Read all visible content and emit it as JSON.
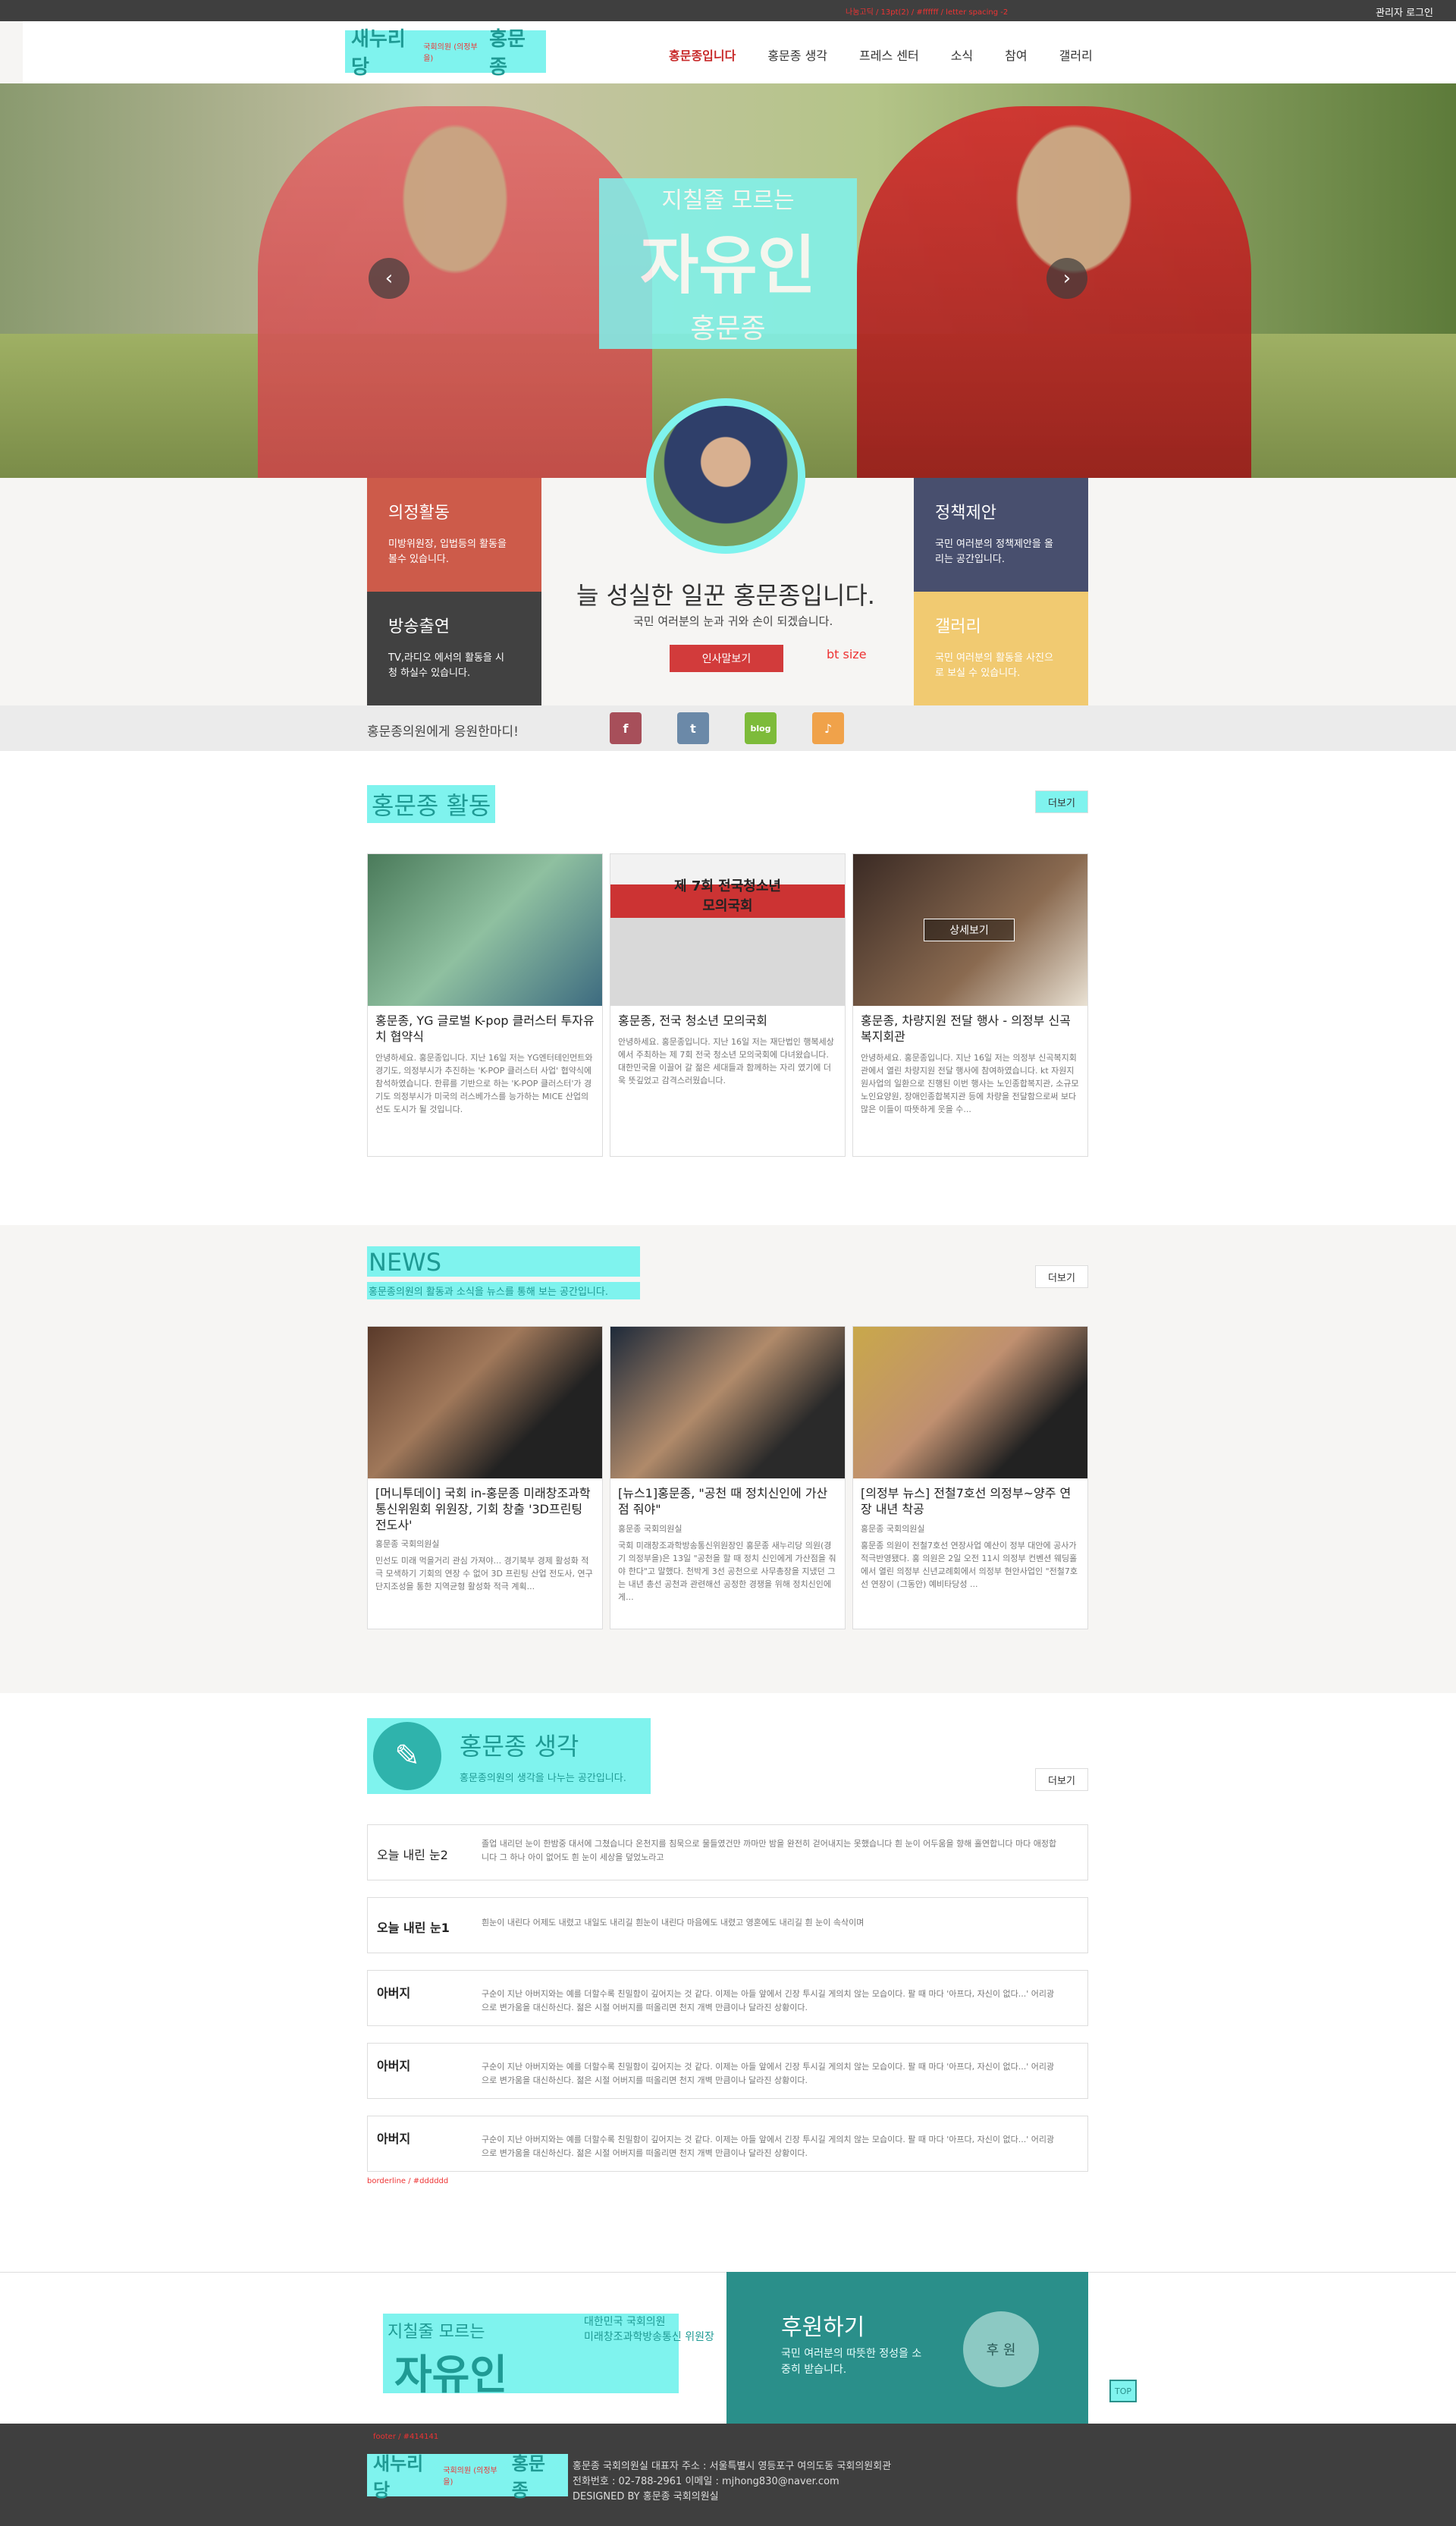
{
  "topbar": {
    "admin": "관리자 로그인"
  },
  "logo": {
    "party": "새누리당",
    "small": "국회의원 (의정부을)",
    "name": "홍문종"
  },
  "nav": {
    "items": [
      "홍문종입니다",
      "홍문종 생각",
      "프레스 센터",
      "소식",
      "참여",
      "갤러리"
    ],
    "active_index": 0
  },
  "hero": {
    "slogan_line1": "지칠줄 모르는",
    "slogan_line2": "자유인",
    "slogan_line3": "홍문종",
    "prev_icon": "chevron-left-icon",
    "next_icon": "chevron-right-icon"
  },
  "boxes": {
    "activity": {
      "title": "의정활동",
      "desc": "미방위원장, 입법등의 활동을 볼수 있습니다.",
      "color": "#cd5b4a"
    },
    "broadcast": {
      "title": "방송출연",
      "desc": "TV,라디오 에서의 활동을 시청 하실수 있습니다.",
      "color": "#414141"
    },
    "policy": {
      "title": "정책제안",
      "desc": "국민 여러분의 정책제안을 올리는 공간입니다.",
      "color": "#484f6e"
    },
    "gallery": {
      "title": "갤러리",
      "desc": "국민 여러분의 활동을 사진으로 보실 수 있습니다.",
      "color": "#f1ca71"
    }
  },
  "intro": {
    "headline": "늘 성실한 일꾼 홍문종입니다.",
    "sub": "국민 여러분의 눈과 귀와 손이 되겠습니다.",
    "greeting_button": "인사말보기",
    "bt_size": "bt size"
  },
  "support": {
    "text": "홍문종의원에게 응원한마디!",
    "sns": [
      {
        "name": "facebook",
        "label": "f",
        "color": "#a74f5a"
      },
      {
        "name": "twitter",
        "label": "t",
        "color": "#6b89a8"
      },
      {
        "name": "blog",
        "label": "blog",
        "color": "#7dbb3a"
      },
      {
        "name": "kakao",
        "label": "♪",
        "color": "#f0a24a"
      }
    ]
  },
  "activity_section": {
    "title": "홍문종 활동",
    "more": "더보기",
    "detail_button": "상세보기",
    "cards": [
      {
        "title": "홍문종, YG 글로벌 K-pop 클러스터 투자유치 협약식",
        "body": "안녕하세요. 홍문종입니다. 지난 16일 저는 YG엔터테인먼트와 경기도, 의정부시가 추진하는 'K-POP 클러스터 사업' 협약식에 참석하였습니다. 한류를 기반으로 하는 'K-POP 클러스터'가 경기도 의정부시가 미국의 러스베가스를 능가하는 MICE 산업의 선도 도시가 될 것입니다."
      },
      {
        "title": "홍문종, 전국 청소년 모의국회",
        "body": "안녕하세요. 홍문종입니다. 지난 16일 저는 재단법인 행복세상에서 주최하는 제 7회 전국 청소년 모의국회에 다녀왔습니다. 대한민국을 이끌어 갈 젊은 세대들과 함께하는 자리 였기에 더욱 뜻깊었고 감격스러웠습니다.",
        "banner": "제 7회 전국청소년모의국회"
      },
      {
        "title": "홍문종, 차량지원 전달 행사 - 의정부 신곡복지회관",
        "body": "안녕하세요. 홍문종입니다. 지난 16일 저는 의정부 신곡복지회관에서 열린 차량지원 전달 행사에 참여하였습니다. kt 자원지원사업의 일환으로 진행된 이번 행사는 노인종합복지관, 소규모노인요양원, 장애인종합복지관 등에 차량을 전달함으로써 보다 많은 이들이 따뜻하게 웃을 수..."
      }
    ]
  },
  "news_section": {
    "title": "NEWS",
    "subtitle": "홍문종의원의 활동과 소식을 뉴스를 통해 보는 공간입니다.",
    "more": "더보기",
    "cards": [
      {
        "title": "[머니투데이] 국회 in-홍문종 미래창조과학통신위원회 위원장, 기회 창출 '3D프린팅 전도사'",
        "source": "홍문종 국회의원실",
        "body": "민선도 미래 먹을거리 관심 가져야... 경기북부 경제 활성화 적극 모색하기 기회의 연장 수 없어 3D 프린팅 산업 전도사, 연구단지조성을 통한 지역균형 활성화 적극 계획..."
      },
      {
        "title": "[뉴스1]홍문종, \"공천 때 정치신인에 가산점 줘야\"",
        "source": "홍문종 국회의원실",
        "body": "국회 미래창조과학방송통신위원장인 홍문종 새누리당 의원(경기 의정부을)은 13일 \"공천을 할 때 정치 신인에게 가산점을 줘야 한다\"고 말했다. 천박게 3선 공천으로 사무총장을 지냈던 그는 내년 총선 공천과 관련해선 공정한 경쟁을 위해 정치신인에게..."
      },
      {
        "title": "[의정부 뉴스] 전철7호선 의정부~양주 연장 내년 착공",
        "source": "홍문종 국회의원실",
        "body": "홍문종 의원이 전철7호선 연장사업 예산이 정부 대안에 공사가 적극반영됐다. 홍 의원은 2일 오전 11시 의정부 컨벤션 웨딩홀에서 열린 의정부 신년교례회에서 의정부 현안사업인 \"전철7호선 연장이 (그동안) 예비타당성 ..."
      }
    ]
  },
  "thought_section": {
    "title": "홍문종 생각",
    "subtitle": "홍문종의원의 생각을 나누는 공간입니다.",
    "more": "더보기",
    "items": [
      {
        "title": "오늘 내린 눈2",
        "body": "졸업 내리던 눈이 한밤중 대서에 그쳤습니다 온천지를 침묵으로 물들였건만 까마만 밤을 완전히 걷어내지는 못했습니다 흰 눈이 어두움을 향해 홀연합니다 마다 애정합니다 그 하나 아이 없어도 흰 눈이 세상을 덮었노라고"
      },
      {
        "title": "오늘 내린 눈1",
        "body": "흰눈이 내린다 어제도 내렸고 내일도 내리길 흰눈이 내린다 마음에도 내렸고 영혼에도 내리길 흰 눈이 속삭이며"
      },
      {
        "title": "아버지",
        "body": "구순이 지난 아버지와는 예를 더할수록 친밀함이 깊어지는 것 같다. 이제는 아들 앞에서 긴장 투시길 게의치 않는 모습이다. 팔 때 마다 '아프다, 자신이 없다...' 어리광으로 변가움을 대신하신다. 젊은 시절 어버지를 떠올리면 천지 개벽 만큼이나 달라진 상황이다."
      },
      {
        "title": "아버지",
        "body": "구순이 지난 아버지와는 예를 더할수록 친밀함이 깊어지는 것 같다. 이제는 아들 앞에서 긴장 투시길 게의치 않는 모습이다. 팔 때 마다 '아프다, 자신이 없다...' 어리광으로 변가움을 대신하신다. 젊은 시절 어버지를 떠올리면 천지 개벽 만큼이나 달라진 상황이다."
      },
      {
        "title": "아버지",
        "body": "구순이 지난 아버지와는 예를 더할수록 친밀함이 깊어지는 것 같다. 이제는 아들 앞에서 긴장 투시길 게의치 않는 모습이다. 팔 때 마다 '아프다, 자신이 없다...' 어리광으로 변가움을 대신하신다. 젊은 시절 어버지를 떠올리면 천지 개벽 만큼이나 달라진 상황이다."
      }
    ]
  },
  "banner": {
    "slogan_small": "지칠줄 모르는",
    "slogan_big": "자유인",
    "role": "대한민국 국회의원",
    "committee": "미래창조과학방송통신 위원장"
  },
  "donate": {
    "title": "후원하기",
    "desc": "국민 여러분의 따뜻한 정성을 소중히 받습니다.",
    "button": "후 원"
  },
  "top_button": "TOP",
  "footer": {
    "line1": "홍문종 국회의원실 대표자 주소 : 서울특별시 영등포구 여의도동 국회의원회관",
    "line2": "전화번호 : 02-788-2961 이메일 : mjhong830@naver.com",
    "line3": "DESIGNED BY 홍문종 국회의원실"
  },
  "spec_notes": {
    "n1": "나눔고딕 / 13pt(2) / #ffffff / letter spacing -2",
    "n2": "borderline / #dddddd",
    "n3": "footer / #414141"
  }
}
